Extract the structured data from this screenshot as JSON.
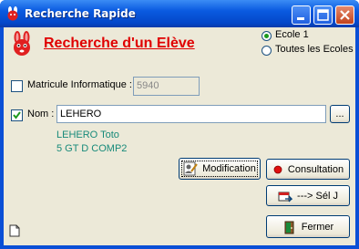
{
  "window": {
    "title": "Recherche Rapide"
  },
  "heading": "Recherche d'un Elève",
  "school_options": [
    {
      "label": "Ecole 1",
      "selected": true
    },
    {
      "label": "Toutes les Ecoles",
      "selected": false
    }
  ],
  "matricule": {
    "label": "Matricule Informatique :",
    "checked": false,
    "value": "5940"
  },
  "nom": {
    "label": "Nom :",
    "checked": true,
    "value": "LEHERO",
    "browse_label": "..."
  },
  "result": {
    "name": "LEHERO Toto",
    "class": "5 GT D COMP2"
  },
  "buttons": {
    "modification": "Modification",
    "consultation": "Consultation",
    "sel_j": "---> Sél J",
    "fermer": "Fermer"
  },
  "colors": {
    "titlebar": "#0a5ae0",
    "heading": "#e00000",
    "result_text": "#178a7a"
  }
}
